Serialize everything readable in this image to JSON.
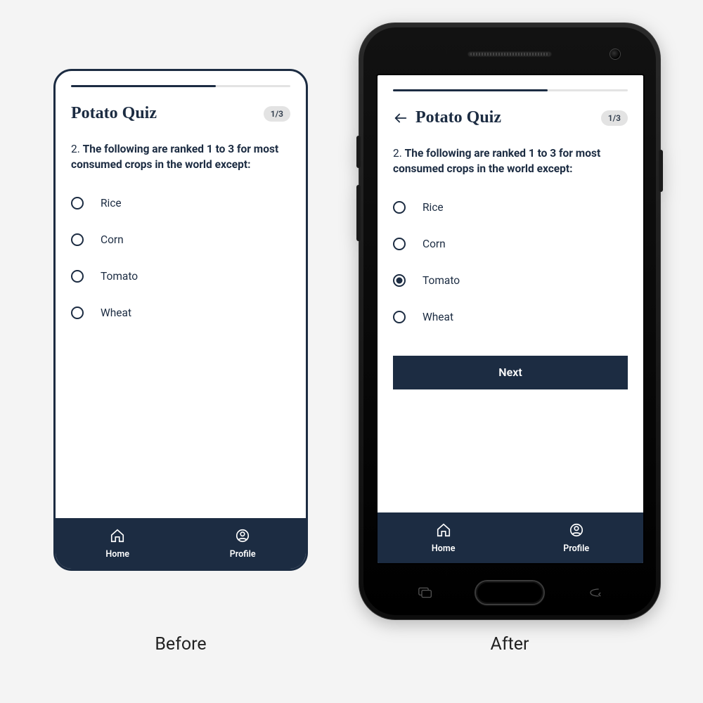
{
  "captions": {
    "before": "Before",
    "after": "After"
  },
  "colors": {
    "accent": "#1c2c42",
    "track": "#e3e3e3",
    "pill": "#e3e3e3"
  },
  "left": {
    "progress_pct": 66,
    "title": "Potato Quiz",
    "counter": "1/3",
    "has_back": false,
    "question_number": "2.",
    "question": "The following are ranked 1 to 3 for most consumed crops in the world except:",
    "options": [
      {
        "label": "Rice",
        "selected": false
      },
      {
        "label": "Corn",
        "selected": false
      },
      {
        "label": "Tomato",
        "selected": false
      },
      {
        "label": "Wheat",
        "selected": false
      }
    ],
    "has_next": false,
    "nav": {
      "home": "Home",
      "profile": "Profile"
    }
  },
  "right": {
    "progress_pct": 66,
    "title": "Potato Quiz",
    "counter": "1/3",
    "has_back": true,
    "question_number": "2.",
    "question": "The following are ranked 1 to 3 for most consumed crops in the world except:",
    "options": [
      {
        "label": "Rice",
        "selected": false
      },
      {
        "label": "Corn",
        "selected": false
      },
      {
        "label": "Tomato",
        "selected": true
      },
      {
        "label": "Wheat",
        "selected": false
      }
    ],
    "has_next": true,
    "next_label": "Next",
    "nav": {
      "home": "Home",
      "profile": "Profile"
    }
  }
}
